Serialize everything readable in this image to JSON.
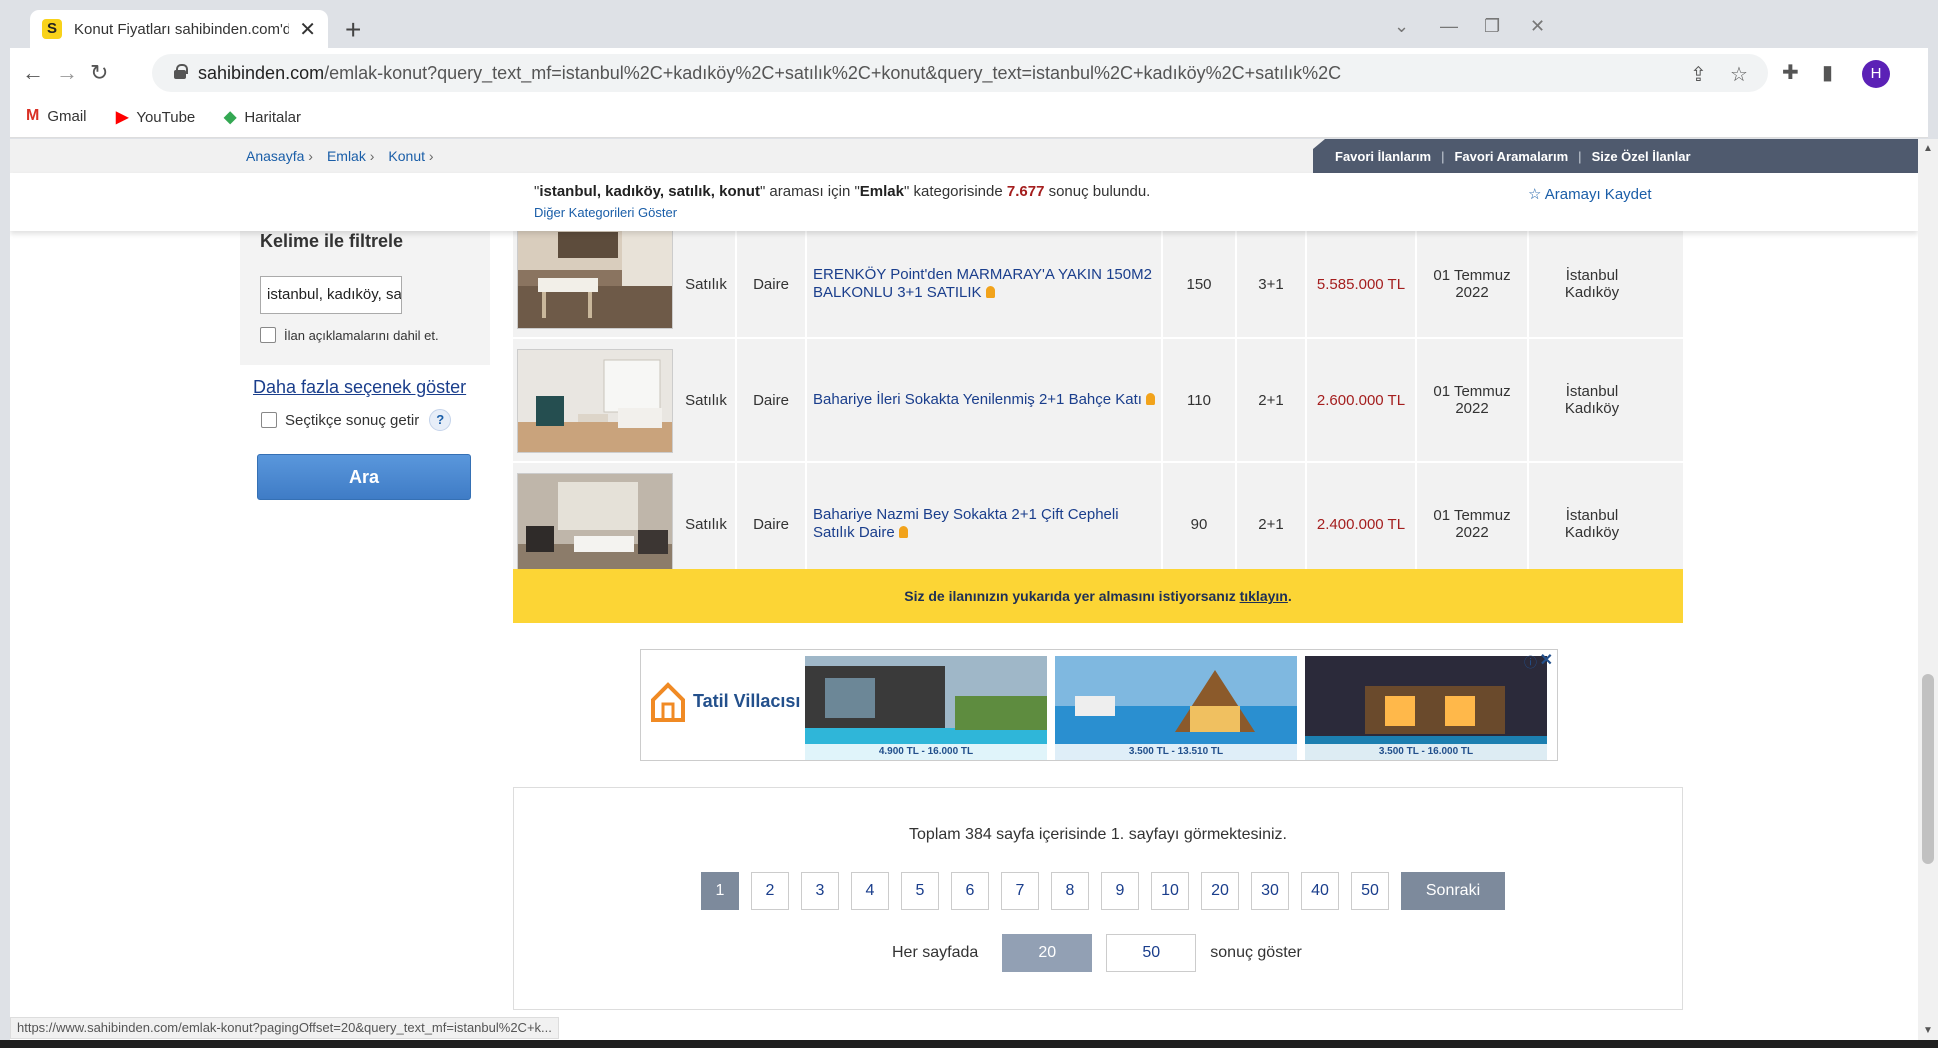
{
  "browser": {
    "tab_title": "Konut Fiyatları sahibinden.com'd",
    "tab_favicon": "S",
    "url_host": "sahibinden.com",
    "url_path": "/emlak-konut?query_text_mf=istanbul%2C+kadıköy%2C+satılık%2C+konut&query_text=istanbul%2C+kadıköy%2C+satılık%2C",
    "avatar_letter": "H",
    "bookmarks": [
      {
        "label": "Gmail",
        "icon": "gmail-icon",
        "icon_char": "M",
        "color": "#d93025"
      },
      {
        "label": "YouTube",
        "icon": "youtube-icon",
        "icon_char": "▶",
        "color": "#ff0000"
      },
      {
        "label": "Haritalar",
        "icon": "maps-icon",
        "icon_char": "◆",
        "color": "#34a853"
      }
    ]
  },
  "breadcrumb": [
    "Anasayfa",
    "Emlak",
    "Konut"
  ],
  "fav_links": [
    "Favori İlanlarım",
    "Favori Aramalarım",
    "Size Özel İlanlar"
  ],
  "search_summary": {
    "quote_open": "\"",
    "query": "istanbul, kadıköy, satılık, konut",
    "mid1": "\" araması için \"",
    "category": "Emlak",
    "mid2": "\" kategorisinde ",
    "count": "7.677",
    "tail": " sonuç bulundu.",
    "other_categories": "Diğer Kategorileri Göster",
    "save_search": "Aramayı Kaydet"
  },
  "filters": {
    "title": "Kelime ile filtrele",
    "keyword_value": "istanbul, kadıköy, satılık, konut",
    "include_desc_label": "İlan açıklamalarını dahil et.",
    "more_options": "Daha fazla seçenek göster",
    "auto_results_label": "Seçtikçe sonuç getir",
    "help": "?",
    "search_button": "Ara"
  },
  "listings": [
    {
      "status": "Satılık",
      "type": "Daire",
      "title": "ERENKÖY Point'den MARMARAY'A YAKIN 150M2 BALKONLU 3+1 SATILIK",
      "m2": "150",
      "rooms": "3+1",
      "price": "5.585.000 TL",
      "date": "01 Temmuz 2022",
      "location": "İstanbul Kadıköy"
    },
    {
      "status": "Satılık",
      "type": "Daire",
      "title": "Bahariye İleri Sokakta Yenilenmiş 2+1 Bahçe Katı",
      "m2": "110",
      "rooms": "2+1",
      "price": "2.600.000 TL",
      "date": "01 Temmuz 2022",
      "location": "İstanbul Kadıköy"
    },
    {
      "status": "Satılık",
      "type": "Daire",
      "title": "Bahariye Nazmi Bey Sokakta 2+1 Çift Cepheli Satılık Daire",
      "m2": "90",
      "rooms": "2+1",
      "price": "2.400.000 TL",
      "date": "01 Temmuz 2022",
      "location": "İstanbul Kadıköy"
    }
  ],
  "promo": {
    "text": "Siz de ilanınızın yukarıda yer almasını istiyorsanız ",
    "link": "tıklayın",
    "end": "."
  },
  "ad": {
    "brand": "Tatil Villacısı",
    "prices": [
      "4.900 TL - 16.000 TL",
      "3.500 TL - 13.510 TL",
      "3.500 TL - 16.000 TL"
    ]
  },
  "pagination": {
    "summary": "Toplam 384 sayfa içerisinde 1. sayfayı görmektesiniz.",
    "pages": [
      "1",
      "2",
      "3",
      "4",
      "5",
      "6",
      "7",
      "8",
      "9",
      "10",
      "20",
      "30",
      "40",
      "50"
    ],
    "current": "1",
    "next": "Sonraki",
    "per_page_label": "Her sayfada",
    "per_page_options": [
      "20",
      "50"
    ],
    "per_page_selected": "20",
    "per_page_suffix": "sonuç göster"
  },
  "status_url": "https://www.sahibinden.com/emlak-konut?pagingOffset=20&query_text_mf=istanbul%2C+k...",
  "colors": {
    "price": "#a41e1e",
    "link": "#1a3e8c",
    "promo": "#fcd535",
    "nav_dark": "#4f5a6e"
  }
}
